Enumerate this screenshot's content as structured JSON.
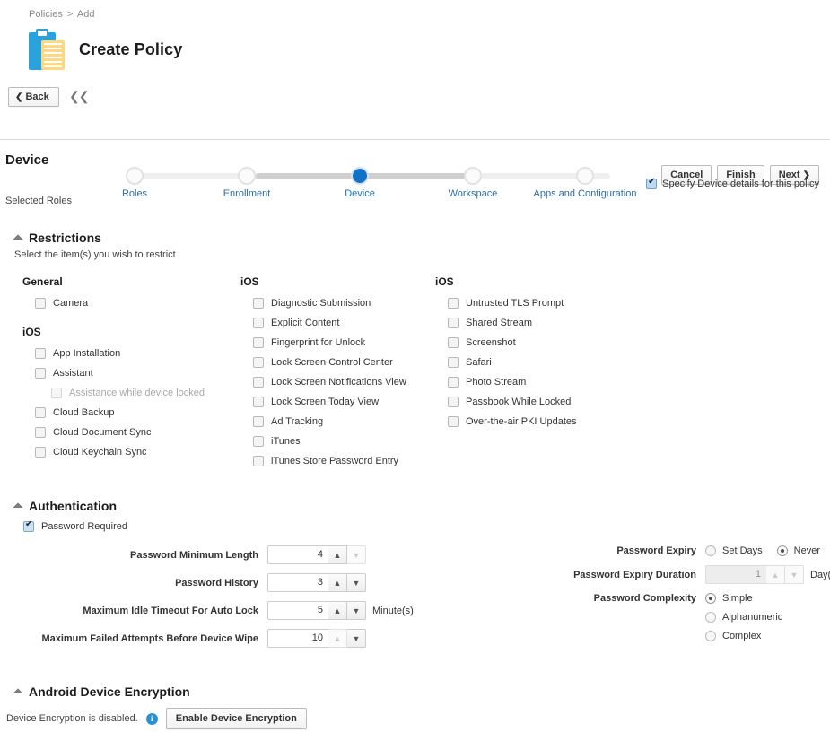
{
  "breadcrumb": {
    "parent": "Policies",
    "separator": ">",
    "current": "Add"
  },
  "header": {
    "title": "Create Policy",
    "icon": "clipboard-icon"
  },
  "nav": {
    "back_label": "Back",
    "collapse_icon": "double-chevron-left-icon",
    "cancel_label": "Cancel",
    "finish_label": "Finish",
    "next_label": "Next",
    "steps": [
      {
        "label": "Roles",
        "state": "todo"
      },
      {
        "label": "Enrollment",
        "state": "todo"
      },
      {
        "label": "Device",
        "state": "current"
      },
      {
        "label": "Workspace",
        "state": "todo"
      },
      {
        "label": "Apps and Configuration",
        "state": "todo"
      }
    ]
  },
  "page": {
    "section_title": "Device",
    "specify_checkbox_label": "Specify Device details for this policy",
    "specify_checked": true,
    "selected_roles_label": "Selected Roles"
  },
  "restrictions": {
    "heading": "Restrictions",
    "subtitle": "Select the item(s) you wish to restrict",
    "columns": [
      {
        "groups": [
          {
            "title": "General",
            "items": [
              {
                "label": "Camera",
                "checked": false,
                "indent": false,
                "disabled": false
              }
            ]
          },
          {
            "title": "iOS",
            "items": [
              {
                "label": "App Installation",
                "checked": false,
                "indent": false,
                "disabled": false
              },
              {
                "label": "Assistant",
                "checked": false,
                "indent": false,
                "disabled": false
              },
              {
                "label": "Assistance while device locked",
                "checked": false,
                "indent": true,
                "disabled": true
              },
              {
                "label": "Cloud Backup",
                "checked": false,
                "indent": false,
                "disabled": false
              },
              {
                "label": "Cloud Document Sync",
                "checked": false,
                "indent": false,
                "disabled": false
              },
              {
                "label": "Cloud Keychain Sync",
                "checked": false,
                "indent": false,
                "disabled": false
              }
            ]
          }
        ]
      },
      {
        "groups": [
          {
            "title": "iOS",
            "items": [
              {
                "label": "Diagnostic Submission",
                "checked": false,
                "indent": false,
                "disabled": false
              },
              {
                "label": "Explicit Content",
                "checked": false,
                "indent": false,
                "disabled": false
              },
              {
                "label": "Fingerprint for Unlock",
                "checked": false,
                "indent": false,
                "disabled": false
              },
              {
                "label": "Lock Screen Control Center",
                "checked": false,
                "indent": false,
                "disabled": false
              },
              {
                "label": "Lock Screen Notifications View",
                "checked": false,
                "indent": false,
                "disabled": false
              },
              {
                "label": "Lock Screen Today View",
                "checked": false,
                "indent": false,
                "disabled": false
              },
              {
                "label": "Ad Tracking",
                "checked": false,
                "indent": false,
                "disabled": false
              },
              {
                "label": "iTunes",
                "checked": false,
                "indent": false,
                "disabled": false
              },
              {
                "label": "iTunes Store Password Entry",
                "checked": false,
                "indent": false,
                "disabled": false
              }
            ]
          }
        ]
      },
      {
        "groups": [
          {
            "title": "iOS",
            "items": [
              {
                "label": "Untrusted TLS Prompt",
                "checked": false,
                "indent": false,
                "disabled": false
              },
              {
                "label": "Shared Stream",
                "checked": false,
                "indent": false,
                "disabled": false
              },
              {
                "label": "Screenshot",
                "checked": false,
                "indent": false,
                "disabled": false
              },
              {
                "label": "Safari",
                "checked": false,
                "indent": false,
                "disabled": false
              },
              {
                "label": "Photo Stream",
                "checked": false,
                "indent": false,
                "disabled": false
              },
              {
                "label": "Passbook While Locked",
                "checked": false,
                "indent": false,
                "disabled": false
              },
              {
                "label": "Over-the-air PKI Updates",
                "checked": false,
                "indent": false,
                "disabled": false
              }
            ]
          }
        ]
      }
    ]
  },
  "authentication": {
    "heading": "Authentication",
    "password_required_label": "Password Required",
    "password_required_checked": true,
    "left_fields": [
      {
        "label": "Password Minimum Length",
        "value": "4",
        "unit": "",
        "disabled": false,
        "up_enabled": true,
        "down_enabled": false
      },
      {
        "label": "Password History",
        "value": "3",
        "unit": "",
        "disabled": false,
        "up_enabled": true,
        "down_enabled": true
      },
      {
        "label": "Maximum Idle Timeout For Auto Lock",
        "value": "5",
        "unit": "Minute(s)",
        "disabled": false,
        "up_enabled": true,
        "down_enabled": true
      },
      {
        "label": "Maximum Failed Attempts Before Device Wipe",
        "value": "10",
        "unit": "",
        "disabled": false,
        "up_enabled": false,
        "down_enabled": true
      }
    ],
    "password_expiry": {
      "label": "Password Expiry",
      "options": [
        {
          "label": "Set Days",
          "selected": false
        },
        {
          "label": "Never",
          "selected": true
        }
      ]
    },
    "password_expiry_duration": {
      "label": "Password Expiry Duration",
      "value": "1",
      "unit": "Day(s)",
      "disabled": true
    },
    "password_complexity": {
      "label": "Password Complexity",
      "options": [
        {
          "label": "Simple",
          "selected": true
        },
        {
          "label": "Alphanumeric",
          "selected": false
        },
        {
          "label": "Complex",
          "selected": false
        }
      ]
    }
  },
  "android_encryption": {
    "heading": "Android Device Encryption",
    "status_text": "Device Encryption is disabled.",
    "info_icon": "info-icon",
    "button_label": "Enable Device Encryption"
  },
  "colors": {
    "accent_blue": "#1072c6",
    "link_blue": "#2b6ca3",
    "icon_blue": "#2aa3dd",
    "icon_yellow": "#fdd87e",
    "info_blue": "#2b8fd4"
  }
}
